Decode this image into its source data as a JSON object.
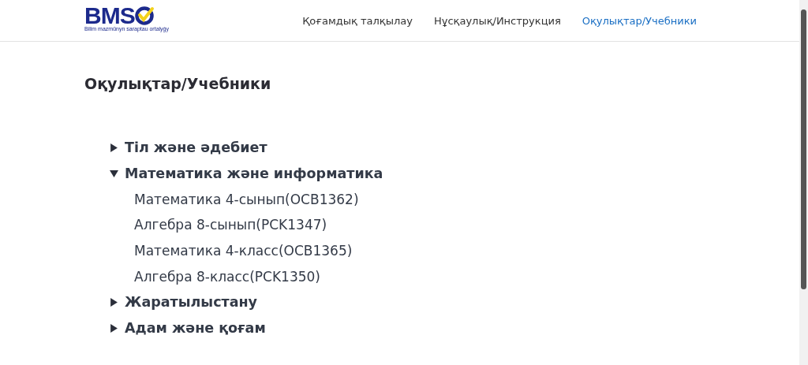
{
  "logo": {
    "text": "BMS",
    "tagline": "Bilim mazmūnyn saraptau ortalyǵy"
  },
  "nav": [
    {
      "label": "Қоғамдық талқылау",
      "selected": false
    },
    {
      "label": "Нұсқаулық/Инструкция",
      "selected": false
    },
    {
      "label": "Оқулықтар/Учебники",
      "selected": true
    }
  ],
  "page_title": "Оқулықтар/Учебники",
  "tree": [
    {
      "label": "Тіл және әдебиет",
      "expanded": false
    },
    {
      "label": "Математика және информатика",
      "expanded": true,
      "children": [
        {
          "label": "Математика 4-сынып(OCB1362)"
        },
        {
          "label": "Алгебра 8-сынып(PCK1347)"
        },
        {
          "label": "Математика 4-класс(OCB1365)"
        },
        {
          "label": "Алгебра 8-класс(PCK1350)"
        }
      ]
    },
    {
      "label": "Жаратылыстану",
      "expanded": false
    },
    {
      "label": "Адам және қоғам",
      "expanded": false
    }
  ]
}
